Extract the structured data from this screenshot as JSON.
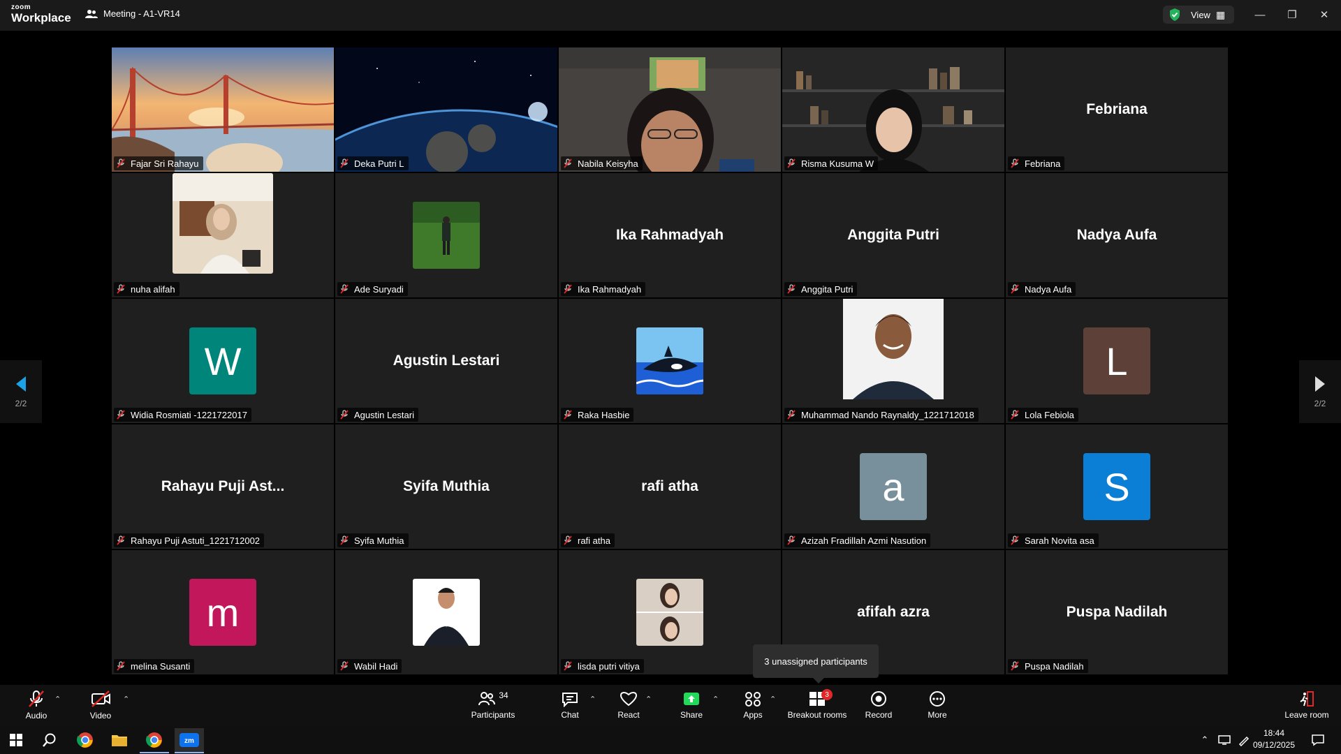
{
  "titlebar": {
    "logo_line1": "zoom",
    "logo_line2": "Workplace",
    "meeting_title": "Meeting - A1-VR14",
    "view_label": "View"
  },
  "colors": {
    "accent": "#0e72ed",
    "muted_mic": "#e02828",
    "share_green": "#23d959",
    "security_green": "#23b35c"
  },
  "pagination": {
    "left": "2/2",
    "right": "2/2"
  },
  "tiles": [
    {
      "label": "Fajar Sri Rahayu",
      "kind": "video",
      "bg": "golden-gate-sunset"
    },
    {
      "label": "Deka Putri L",
      "kind": "video",
      "bg": "earth-from-space"
    },
    {
      "label": "Nabila Keisyha",
      "kind": "video",
      "bg": "person-sofa"
    },
    {
      "label": "Risma Kusuma W",
      "kind": "video",
      "bg": "bookshelf-room"
    },
    {
      "label": "Febriana",
      "kind": "name",
      "display": "Febriana"
    },
    {
      "label": "nuha alifah",
      "kind": "photo",
      "bg": "portrait-hijab"
    },
    {
      "label": "Ade Suryadi",
      "kind": "photo",
      "bg": "grass-field"
    },
    {
      "label": "Ika Rahmadyah",
      "kind": "name",
      "display": "Ika Rahmadyah"
    },
    {
      "label": "Anggita Putri",
      "kind": "name",
      "display": "Anggita Putri"
    },
    {
      "label": "Nadya Aufa",
      "kind": "name",
      "display": "Nadya Aufa"
    },
    {
      "label": "Widia Rosmiati -1221722017",
      "kind": "avatar",
      "letter": "W",
      "color": "#00857a"
    },
    {
      "label": "Agustin Lestari",
      "kind": "name",
      "display": "Agustin Lestari"
    },
    {
      "label": "Raka Hasbie",
      "kind": "photo",
      "bg": "orca-cartoon"
    },
    {
      "label": "Muhammad Nando Raynaldy_1221712018",
      "kind": "photo-large",
      "bg": "portrait-man"
    },
    {
      "label": "Lola Febiola",
      "kind": "avatar",
      "letter": "L",
      "color": "#5d4037"
    },
    {
      "label": "Rahayu Puji Astuti_1221712002",
      "kind": "name",
      "display": "Rahayu Puji Ast..."
    },
    {
      "label": "Syifa Muthia",
      "kind": "name",
      "display": "Syifa Muthia"
    },
    {
      "label": "rafi atha",
      "kind": "name",
      "display": "rafi atha"
    },
    {
      "label": "Azizah Fradillah Azmi Nasution",
      "kind": "avatar",
      "letter": "a",
      "color": "#78909c"
    },
    {
      "label": "Sarah Novita asa",
      "kind": "avatar",
      "letter": "S",
      "color": "#0b7fd6"
    },
    {
      "label": "melina Susanti",
      "kind": "avatar",
      "letter": "m",
      "color": "#c2185b"
    },
    {
      "label": "Wabil Hadi",
      "kind": "photo",
      "bg": "portrait-suit"
    },
    {
      "label": "lisda putri vitiya",
      "kind": "photo",
      "bg": "portrait-collage"
    },
    {
      "label": "",
      "kind": "name",
      "display": "afifah azra"
    },
    {
      "label": "Puspa Nadilah",
      "kind": "name",
      "display": "Puspa Nadilah"
    }
  ],
  "tooltip": {
    "text": "3 unassigned participants"
  },
  "toolbar": {
    "audio": "Audio",
    "video": "Video",
    "participants": "Participants",
    "participants_count": "34",
    "chat": "Chat",
    "react": "React",
    "share": "Share",
    "apps": "Apps",
    "breakout": "Breakout rooms",
    "breakout_badge": "3",
    "record": "Record",
    "more": "More",
    "leave": "Leave room"
  },
  "taskbar": {
    "time": "18:44",
    "date": "09/12/2025"
  }
}
